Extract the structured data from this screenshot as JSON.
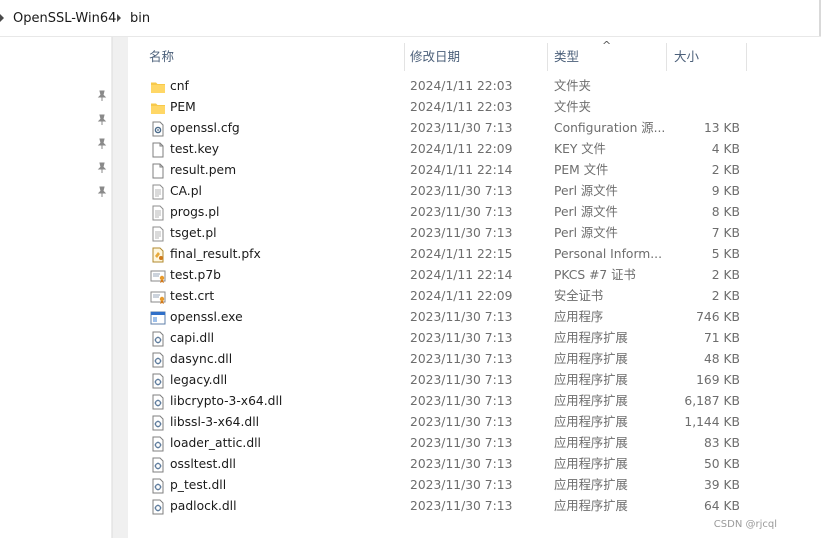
{
  "breadcrumb": {
    "items": [
      "OpenSSL-Win64",
      "bin"
    ]
  },
  "columns": {
    "name": "名称",
    "date": "修改日期",
    "type": "类型",
    "size": "大小"
  },
  "files": [
    {
      "name": "cnf",
      "date": "2024/1/11 22:03",
      "type": "文件夹",
      "size": "",
      "icon": "folder-icon"
    },
    {
      "name": "PEM",
      "date": "2024/1/11 22:03",
      "type": "文件夹",
      "size": "",
      "icon": "folder-icon"
    },
    {
      "name": "openssl.cfg",
      "date": "2023/11/30 7:13",
      "type": "Configuration 源...",
      "size": "13 KB",
      "icon": "config-file-icon"
    },
    {
      "name": "test.key",
      "date": "2024/1/11 22:09",
      "type": "KEY 文件",
      "size": "4 KB",
      "icon": "blank-file-icon"
    },
    {
      "name": "result.pem",
      "date": "2024/1/11 22:14",
      "type": "PEM 文件",
      "size": "2 KB",
      "icon": "blank-file-icon"
    },
    {
      "name": "CA.pl",
      "date": "2023/11/30 7:13",
      "type": "Perl 源文件",
      "size": "9 KB",
      "icon": "text-file-icon"
    },
    {
      "name": "progs.pl",
      "date": "2023/11/30 7:13",
      "type": "Perl 源文件",
      "size": "8 KB",
      "icon": "text-file-icon"
    },
    {
      "name": "tsget.pl",
      "date": "2023/11/30 7:13",
      "type": "Perl 源文件",
      "size": "7 KB",
      "icon": "text-file-icon"
    },
    {
      "name": "final_result.pfx",
      "date": "2024/1/11 22:15",
      "type": "Personal Inform...",
      "size": "5 KB",
      "icon": "pfx-file-icon"
    },
    {
      "name": "test.p7b",
      "date": "2024/1/11 22:14",
      "type": "PKCS #7 证书",
      "size": "2 KB",
      "icon": "certificate-icon"
    },
    {
      "name": "test.crt",
      "date": "2024/1/11 22:09",
      "type": "安全证书",
      "size": "2 KB",
      "icon": "certificate-icon"
    },
    {
      "name": "openssl.exe",
      "date": "2023/11/30 7:13",
      "type": "应用程序",
      "size": "746 KB",
      "icon": "executable-icon"
    },
    {
      "name": "capi.dll",
      "date": "2023/11/30 7:13",
      "type": "应用程序扩展",
      "size": "71 KB",
      "icon": "dll-file-icon"
    },
    {
      "name": "dasync.dll",
      "date": "2023/11/30 7:13",
      "type": "应用程序扩展",
      "size": "48 KB",
      "icon": "dll-file-icon"
    },
    {
      "name": "legacy.dll",
      "date": "2023/11/30 7:13",
      "type": "应用程序扩展",
      "size": "169 KB",
      "icon": "dll-file-icon"
    },
    {
      "name": "libcrypto-3-x64.dll",
      "date": "2023/11/30 7:13",
      "type": "应用程序扩展",
      "size": "6,187 KB",
      "icon": "dll-file-icon"
    },
    {
      "name": "libssl-3-x64.dll",
      "date": "2023/11/30 7:13",
      "type": "应用程序扩展",
      "size": "1,144 KB",
      "icon": "dll-file-icon"
    },
    {
      "name": "loader_attic.dll",
      "date": "2023/11/30 7:13",
      "type": "应用程序扩展",
      "size": "83 KB",
      "icon": "dll-file-icon"
    },
    {
      "name": "ossltest.dll",
      "date": "2023/11/30 7:13",
      "type": "应用程序扩展",
      "size": "50 KB",
      "icon": "dll-file-icon"
    },
    {
      "name": "p_test.dll",
      "date": "2023/11/30 7:13",
      "type": "应用程序扩展",
      "size": "39 KB",
      "icon": "dll-file-icon"
    },
    {
      "name": "padlock.dll",
      "date": "2023/11/30 7:13",
      "type": "应用程序扩展",
      "size": "64 KB",
      "icon": "dll-file-icon"
    }
  ],
  "nav": {
    "pinned_count": 5
  },
  "watermark": "CSDN @rjcql",
  "colors": {
    "folder": "#f7c94b",
    "header_text": "#4c607a",
    "secondary_text": "#6d6d6d",
    "certificate_ribbon": "#e89a2c",
    "exe_blue": "#2f6fc9"
  }
}
